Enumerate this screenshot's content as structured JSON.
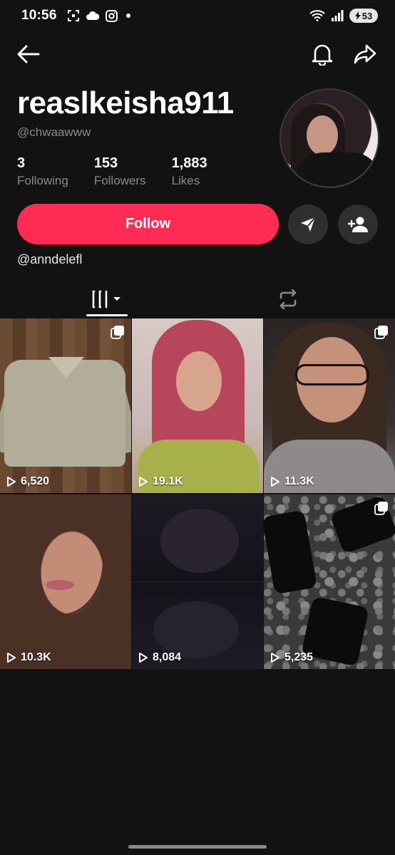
{
  "status_bar": {
    "time": "10:56",
    "battery": "53"
  },
  "profile": {
    "display_name": "reaslkeisha911",
    "handle": "@chwaawww",
    "stats": [
      {
        "value": "3",
        "label": "Following"
      },
      {
        "value": "153",
        "label": "Followers"
      },
      {
        "value": "1,883",
        "label": "Likes"
      }
    ],
    "follow_label": "Follow",
    "bio_link": "@anndelefl"
  },
  "colors": {
    "accent": "#fe2c55",
    "background": "#121212",
    "secondary_text": "#8a8a8a"
  },
  "tabs": [
    {
      "name": "videos-grid",
      "icon": "grid-bars-icon"
    },
    {
      "name": "reposts",
      "icon": "repost-icon"
    }
  ],
  "videos": [
    {
      "views": "6,520",
      "multi": true
    },
    {
      "views": "19.1K",
      "multi": false
    },
    {
      "views": "11.3K",
      "multi": true
    },
    {
      "views": "10.3K",
      "multi": false
    },
    {
      "views": "8,084",
      "multi": false
    },
    {
      "views": "5,235",
      "multi": true
    }
  ]
}
